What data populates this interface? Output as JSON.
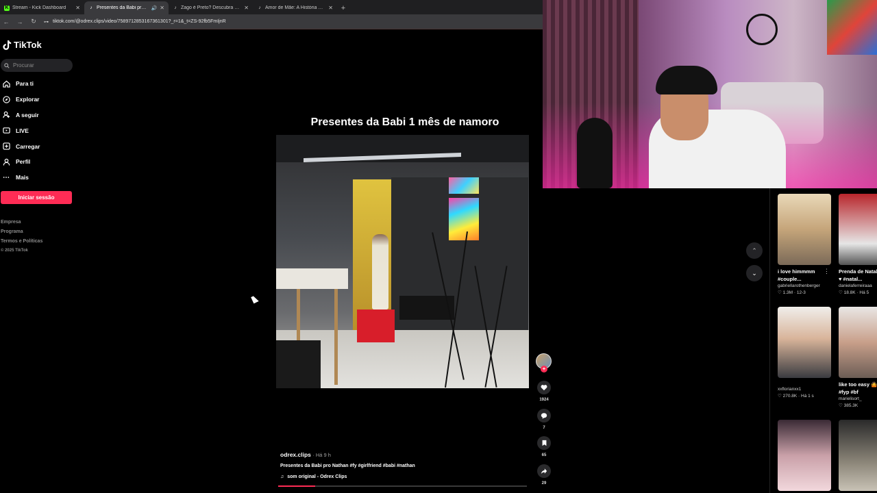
{
  "browser": {
    "tabs": [
      {
        "title": "Stream - Kick Dashboard",
        "favicon": "kick",
        "active": false,
        "audio": false
      },
      {
        "title": "Presentes da Babi pro Nathan",
        "favicon": "tiktok",
        "active": true,
        "audio": true
      },
      {
        "title": "Zago é Preto? Descubra a Verdade",
        "favicon": "tiktok",
        "active": false,
        "audio": false
      },
      {
        "title": "Amor de Mãe: A História de Nathan",
        "favicon": "tiktok",
        "active": false,
        "audio": false
      }
    ],
    "url": "tiktok.com/@odrex.clips/video/7589712853167361301?_r=1&_t=ZS-92fb5FmIjnR"
  },
  "sidebar": {
    "logo": "TikTok",
    "search_placeholder": "Procurar",
    "nav": [
      {
        "label": "Para ti",
        "icon": "home-icon"
      },
      {
        "label": "Explorar",
        "icon": "compass-icon"
      },
      {
        "label": "A seguir",
        "icon": "following-icon"
      },
      {
        "label": "LIVE",
        "icon": "live-icon"
      },
      {
        "label": "Carregar",
        "icon": "upload-icon"
      },
      {
        "label": "Perfil",
        "icon": "profile-icon"
      },
      {
        "label": "Mais",
        "icon": "more-icon"
      }
    ],
    "login_label": "Iniciar sessão",
    "footer": [
      "Empresa",
      "Programa",
      "Termos e Políticas",
      "© 2025 TikTok"
    ]
  },
  "video": {
    "overlay_title": "Presentes da Babi 1 mês de namoro",
    "author": "odrex.clips",
    "posted": "Há 9 h",
    "description": "Presentes da Babi pro Nathan #fy #girlfriend #babi #nathan",
    "sound": "som original - Odrex Clips",
    "likes": "1924",
    "comments": "7",
    "saves": "65",
    "shares": "29",
    "progress_fraction": 0.15
  },
  "recommended": [
    {
      "title": "i love himmmm",
      "title2": "#couple...",
      "user": "gabriellarothenberger",
      "likes": "1.3M",
      "date": "12-3",
      "thumb": "room"
    },
    {
      "title": "Prenda de Natal",
      "title2": "♥ #natal...",
      "user": "danielaferreiraaa",
      "likes": "18.8K",
      "date": "Há 5",
      "thumb": "xmas"
    },
    {
      "title": "",
      "title2": "",
      "user": "xxflorianxx1",
      "likes": "270.8K",
      "date": "Há 1 s",
      "thumb": "guy"
    },
    {
      "title": "like too easy 🤷",
      "title2": "#fyp #bf",
      "user": "marielisort_",
      "likes": "385.3K",
      "date": "",
      "thumb": "couple"
    },
    {
      "title": "",
      "title2": "",
      "user": "",
      "likes": "",
      "date": "",
      "thumb": "girl"
    },
    {
      "title": "",
      "title2": "",
      "user": "",
      "likes": "",
      "date": "",
      "thumb": "room2"
    }
  ],
  "colors": {
    "accent": "#fe2c55",
    "background": "#000000"
  }
}
